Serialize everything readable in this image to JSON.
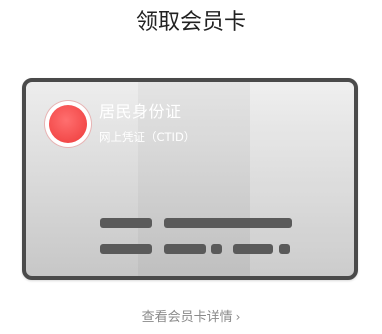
{
  "header": {
    "title": "领取会员卡"
  },
  "card": {
    "name": "居民身份证",
    "subtitle": "网上凭证（CTID）",
    "emblem_icon": "national-emblem-icon",
    "colors": {
      "border": "#4a4a4a",
      "emblem_red": "#f34a4a",
      "masked_bar": "#5a5a5a"
    }
  },
  "footer": {
    "details_link": "查看会员卡详情",
    "chevron_icon": "chevron-right-icon",
    "chevron_glyph": "›"
  }
}
